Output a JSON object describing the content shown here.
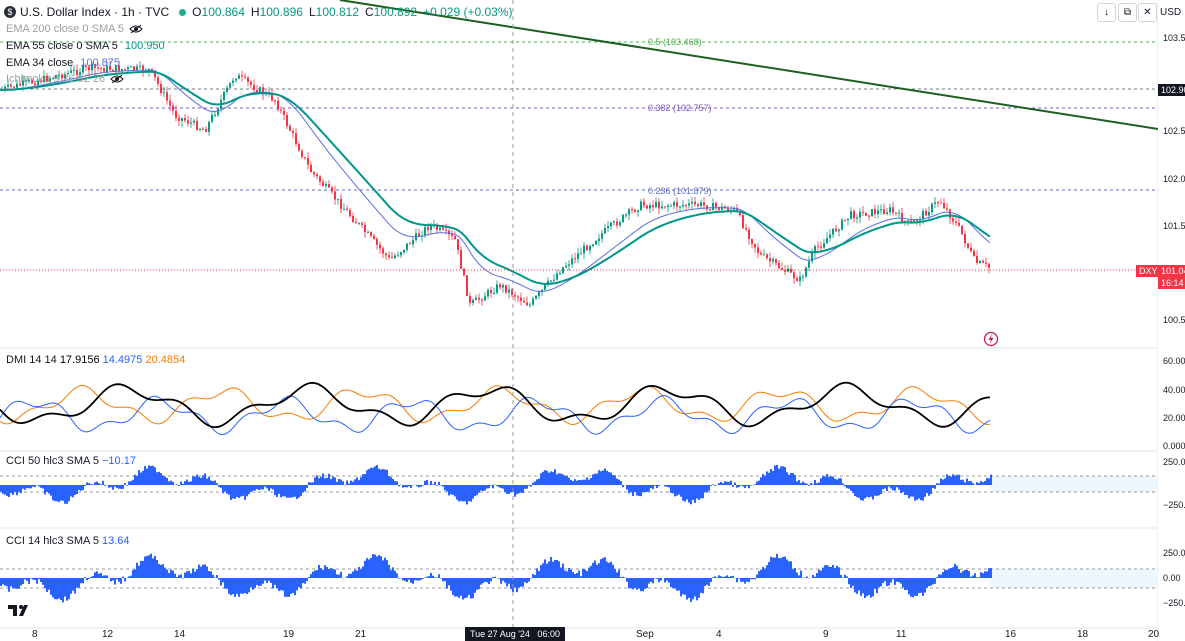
{
  "header": {
    "logo_glyph": "$",
    "symbol": "U.S. Dollar Index · 1h · TVC",
    "open_label": "O",
    "open": "100.864",
    "high_label": "H",
    "high": "100.896",
    "low_label": "L",
    "low": "100.812",
    "close_label": "C",
    "close": "100.892",
    "change": "+0.029 (+0.03%)"
  },
  "studies": [
    {
      "name": "EMA 200 close 0 SMA 5",
      "value": "",
      "color": "#9e9e9e"
    },
    {
      "name": "EMA 55 close 0 SMA 5",
      "value": "100.950",
      "color": "#009688"
    },
    {
      "name": "EMA 34 close",
      "value": "100.875",
      "color": "#5b6ee1"
    },
    {
      "name": "Ichimoku 9 26 52 26",
      "value": "",
      "color": "#9e9e9e"
    }
  ],
  "toolbar": {
    "down_icon": "↓",
    "restore_icon": "⧉",
    "close_icon": "✕",
    "currency": "USD"
  },
  "price_scale": [
    "103.50",
    "102.90",
    "102.50",
    "102.00",
    "101.50",
    "101.04",
    "100.50"
  ],
  "price_tag": {
    "symbol": "DXY",
    "price": "101.04",
    "countdown": "16:14",
    "level_label": "102.90"
  },
  "fib_labels": [
    "0.5 (103.468)",
    "0.382 (102.757)",
    "0.236 (101.879)"
  ],
  "dmi": {
    "label": "DMI 14 14",
    "adx": "17.9156",
    "plus": "14.4975",
    "minus": "20.4854",
    "scale": [
      "60.0000",
      "40.0000",
      "20.0000",
      "0.0000"
    ]
  },
  "cci50": {
    "label": "CCI 50 hlc3 SMA 5",
    "value": "−10.17",
    "scale": [
      "250.00",
      "−250.00"
    ]
  },
  "cci14": {
    "label": "CCI 14 hlc3 SMA 5",
    "value": "13.64",
    "scale": [
      "250.00",
      "0.00",
      "−250.00"
    ]
  },
  "x_axis": [
    "8",
    "12",
    "14",
    "19",
    "21",
    "Sep",
    "4",
    "9",
    "11",
    "16",
    "18",
    "20"
  ],
  "crosshair_label": "Tue 27 Aug '24   06:00",
  "colors": {
    "up": "#089981",
    "down": "#f23645",
    "ema55": "#009688",
    "ema34": "#5b6ee1",
    "trend": "#1b5e20",
    "adx": "#000000",
    "plus": "#2962ff",
    "minus": "#f57c00",
    "cci": "#2962ff"
  }
}
